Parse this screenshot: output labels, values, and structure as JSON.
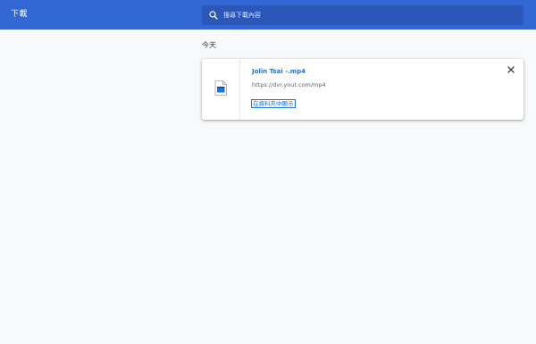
{
  "header": {
    "title": "下載",
    "search_placeholder": "搜尋下載內容",
    "background_color": "#3367d6"
  },
  "section": {
    "heading": "今天"
  },
  "downloads": [
    {
      "file_name": "Jolin Tsai -.mp4",
      "url": "https://dvr.yout.com/mp4",
      "show_in_folder_label": "在資料夾中顯示",
      "icon": "video-file-icon"
    }
  ],
  "colors": {
    "accent": "#1a73e8",
    "page_background": "#f8f9fa"
  }
}
